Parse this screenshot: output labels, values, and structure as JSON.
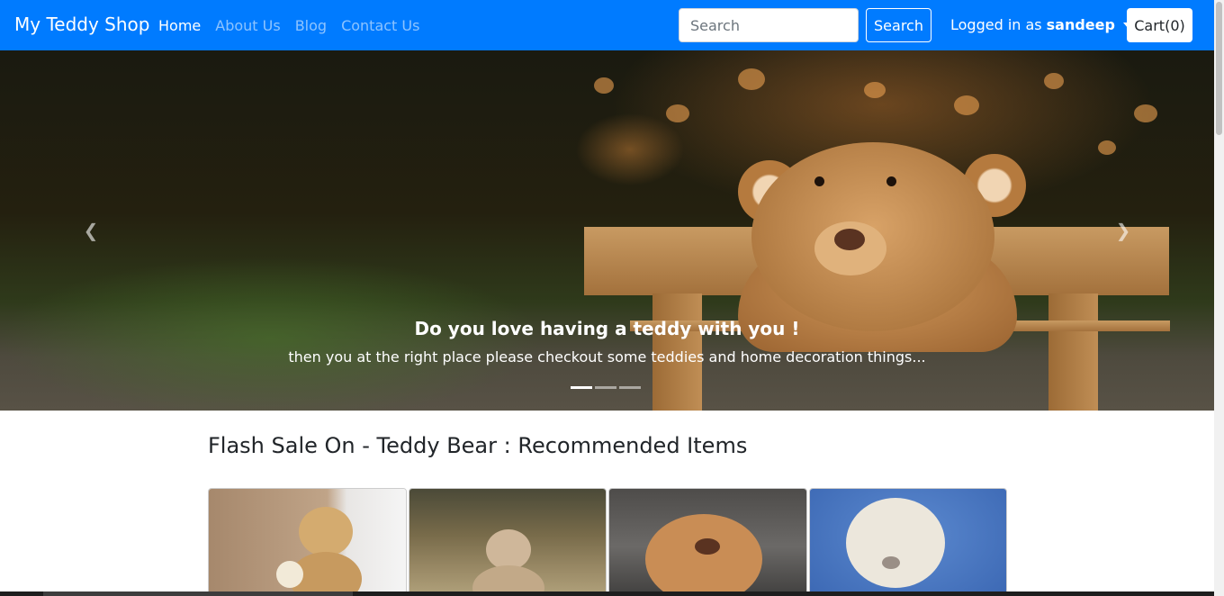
{
  "navbar": {
    "brand": "My Teddy Shop",
    "links": [
      {
        "label": "Home",
        "active": true
      },
      {
        "label": "About Us",
        "active": false
      },
      {
        "label": "Blog",
        "active": false
      },
      {
        "label": "Contact Us",
        "active": false
      }
    ],
    "search": {
      "placeholder": "Search",
      "value": "",
      "button_label": "Search"
    },
    "user": {
      "prefix": "Logged in as",
      "username": "sandeep"
    },
    "cart_label": "Cart(0)",
    "color": "#007bff"
  },
  "carousel": {
    "prev_icon": "chevron-left-icon",
    "next_icon": "chevron-right-icon",
    "caption_title": "Do you love having a teddy with you !",
    "caption_text": "then you at the right place please checkout some teddies and home decoration things...",
    "slide_count": 3,
    "active_slide": 1
  },
  "main": {
    "section_title": "Flash Sale On - Teddy Bear : Recommended Items",
    "products": [
      {
        "image": "teddy-with-flowers-by-curtain"
      },
      {
        "image": "teddy-in-forest"
      },
      {
        "image": "brown-teddy-dark-background"
      },
      {
        "image": "white-teddy-blue-background"
      }
    ]
  }
}
